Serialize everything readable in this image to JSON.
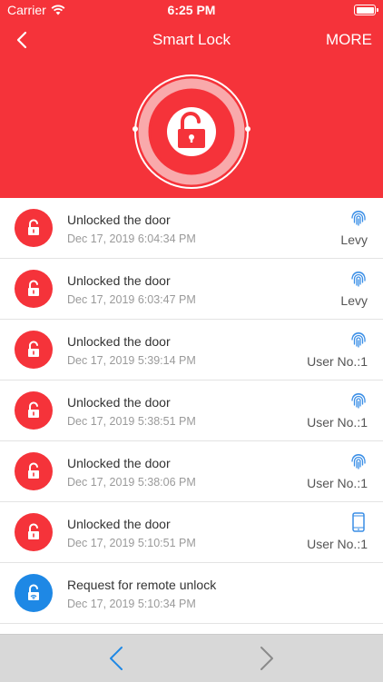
{
  "status_bar": {
    "carrier": "Carrier",
    "time": "6:25 PM"
  },
  "nav": {
    "title": "Smart Lock",
    "more_label": "MORE"
  },
  "colors": {
    "accent": "#f5333a",
    "remote_blue": "#1e88e5",
    "icon_blue": "#3a8ee6"
  },
  "records": [
    {
      "title": "Unlocked the door",
      "time": "Dec 17, 2019 6:04:34 PM",
      "method_icon": "fingerprint-icon",
      "user": "Levy",
      "icon_color": "#f5333a"
    },
    {
      "title": "Unlocked the door",
      "time": "Dec 17, 2019 6:03:47 PM",
      "method_icon": "fingerprint-icon",
      "user": "Levy",
      "icon_color": "#f5333a"
    },
    {
      "title": "Unlocked the door",
      "time": "Dec 17, 2019 5:39:14 PM",
      "method_icon": "fingerprint-icon",
      "user": "User No.:1",
      "icon_color": "#f5333a"
    },
    {
      "title": "Unlocked the door",
      "time": "Dec 17, 2019 5:38:51 PM",
      "method_icon": "fingerprint-icon",
      "user": "User No.:1",
      "icon_color": "#f5333a"
    },
    {
      "title": "Unlocked the door",
      "time": "Dec 17, 2019 5:38:06 PM",
      "method_icon": "fingerprint-icon",
      "user": "User No.:1",
      "icon_color": "#f5333a"
    },
    {
      "title": "Unlocked the door",
      "time": "Dec 17, 2019 5:10:51 PM",
      "method_icon": "phone-icon",
      "user": "User No.:1",
      "icon_color": "#f5333a"
    },
    {
      "title": "Request for remote unlock",
      "time": "Dec 17, 2019 5:10:34 PM",
      "method_icon": "",
      "user": "",
      "icon_color": "#1e88e5"
    },
    {
      "title": "",
      "time": "",
      "method_icon": "fingerprint-icon",
      "user": "",
      "icon_color": "#f5333a"
    }
  ]
}
